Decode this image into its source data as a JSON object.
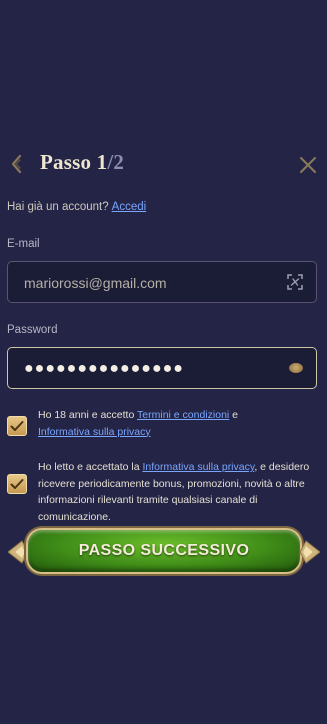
{
  "header": {
    "step_label": "Passo",
    "step_current": "1",
    "step_separator": "/",
    "step_total": "2"
  },
  "login_prompt": {
    "text": "Hai già un account?",
    "link": "Accedi"
  },
  "email": {
    "label": "E-mail",
    "value": "mariorossi@gmail.com"
  },
  "password": {
    "label": "Password",
    "value": "●●●●●●●●●●●●●●●"
  },
  "consent_age": {
    "checked": true,
    "text_before": "Ho 18 anni e accetto ",
    "link_terms": "Termini e condizioni",
    "text_middle": " e",
    "link_privacy": "Informativa sulla privacy"
  },
  "consent_marketing": {
    "checked": true,
    "text_before": "Ho letto e accettato la ",
    "link_privacy": "Informativa sulla privacy",
    "text_after": ", e desidero ricevere periodicamente bonus, promozioni, novità o altre informazioni rilevanti tramite qualsiasi canale di comunicazione."
  },
  "cta": {
    "label": "PASSO SUCCESSIVO"
  },
  "colors": {
    "background": "#232446",
    "link": "#7aa6ff",
    "accent_gold": "#d7bf86",
    "cta_green": "#3f8c18"
  }
}
